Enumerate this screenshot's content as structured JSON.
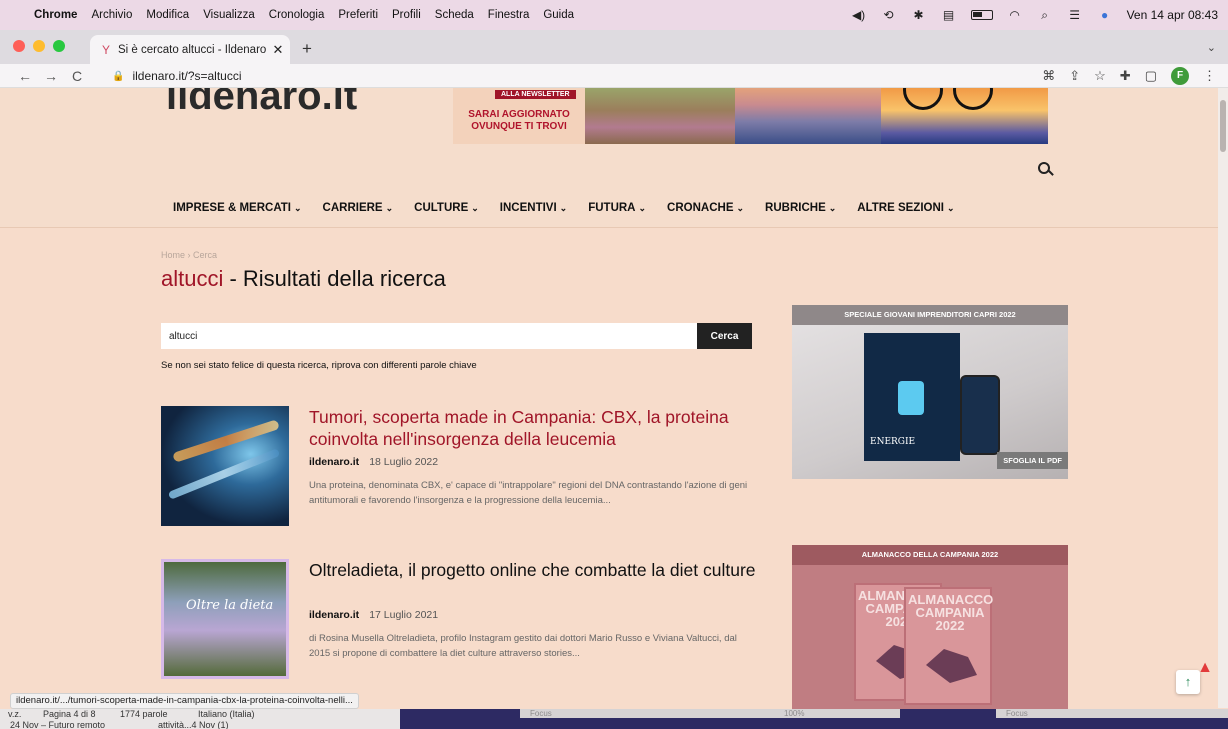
{
  "menubar": {
    "app": "Chrome",
    "items": [
      "Archivio",
      "Modifica",
      "Visualizza",
      "Cronologia",
      "Preferiti",
      "Profili",
      "Scheda",
      "Finestra",
      "Guida"
    ],
    "datetime": "Ven 14 apr  08:43"
  },
  "tab": {
    "title": "Si è cercato altucci - Ildenaro.i",
    "close": "✕",
    "new": "+"
  },
  "address": {
    "url": "ildenaro.it/?s=altucci",
    "profile_initial": "F"
  },
  "site": {
    "logo": "ildenaro.it",
    "banner_tag": "ALLA NEWSLETTER",
    "banner_text_1": "SARAI AGGIORNATO",
    "banner_text_2": "OVUNQUE TI TROVI",
    "nav": [
      "IMPRESE & MERCATI",
      "CARRIERE",
      "CULTURE",
      "INCENTIVI",
      "FUTURA",
      "CRONACHE",
      "RUBRICHE",
      "ALTRE SEZIONI"
    ]
  },
  "breadcrumb": "Home  ›  Cerca",
  "results": {
    "term": "altucci",
    "title_suffix": " - Risultati della ricerca",
    "search_value": "altucci",
    "search_button": "Cerca",
    "hint": "Se non sei stato felice di questa ricerca, riprova con differenti parole chiave"
  },
  "articles": [
    {
      "title": "Tumori, scoperta made in Campania: CBX, la proteina coinvolta nell'insorgenza della leucemia",
      "author": "ildenaro.it",
      "date": "18 Luglio 2022",
      "excerpt": "Una proteina, denominata CBX, e' capace di \"intrappolare\" regioni del DNA contrastando l'azione di geni antitumorali e favorendo l'insorgenza e la progressione della leucemia..."
    },
    {
      "title": "Oltreladieta, il progetto online che combatte la diet culture",
      "author": "ildenaro.it",
      "date": "17 Luglio 2021",
      "excerpt": "di Rosina Musella Oltreladieta, profilo Instagram gestito dai dottori Mario Russo e Viviana Valtucci, dal 2015 si propone di combattere la diet culture attraverso stories...",
      "thumb_text": "Oltre la dieta"
    }
  ],
  "ads": {
    "ad1_head": "SPECIALE GIOVANI IMPRENDITORI  CAPRI 2022",
    "ad1_mag_text": "ENERGIE",
    "ad1_foot": "SFOGLIA IL PDF",
    "ad2_head": "ALMANACCO DELLA CAMPANIA 2022",
    "ad2_book_title": "ALMANACCO CAMPANIA 2022"
  },
  "status_url": "ildenaro.it/.../tumori-scoperta-made-in-campania-cbx-la-proteina-coinvolta-nelli...",
  "word_strip": {
    "t1": "v.z.",
    "t2": "Pagina 4 di 8",
    "t3": "1774 parole",
    "t4": "Italiano (Italia)",
    "b1": "24 Nov – Futuro remoto",
    "b2": "attività...4 Nov (1)",
    "focus": "Focus",
    "zoom": "100%"
  }
}
